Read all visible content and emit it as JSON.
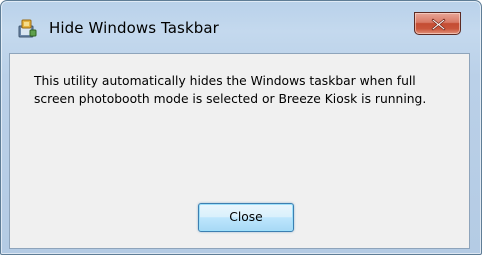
{
  "window": {
    "title": "Hide Windows Taskbar",
    "icon": "photobooth-app-icon"
  },
  "title_bar_buttons": {
    "close_glyph": "close-icon"
  },
  "dialog": {
    "message": "This utility automatically hides the Windows taskbar when full screen photobooth mode is selected or Breeze Kiosk is running.",
    "button_label": "Close"
  },
  "colors": {
    "frame": "#b9d1ea",
    "client": "#f0f0f0",
    "close_button": "#c9553b",
    "default_button_border": "#3c7fb1"
  }
}
